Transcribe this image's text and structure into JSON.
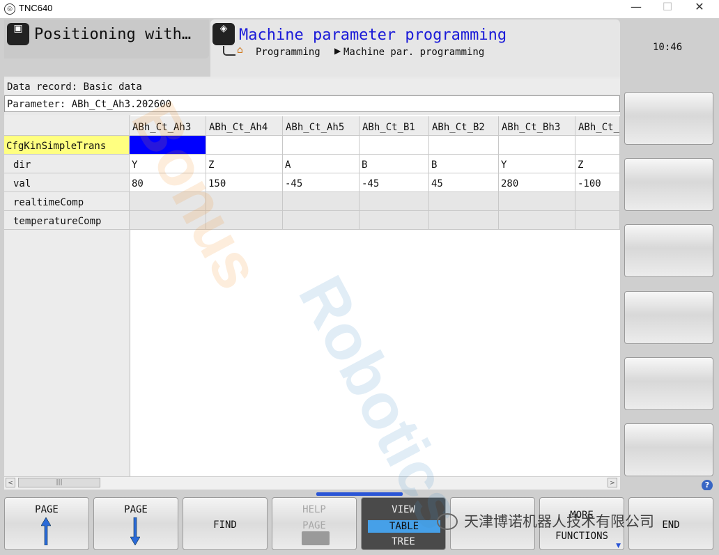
{
  "window": {
    "title": "TNC640",
    "minimize": "—",
    "maximize": "☐",
    "close": "✕"
  },
  "mode_left": {
    "title": "Positioning with…"
  },
  "mode_right": {
    "title": "Machine parameter programming"
  },
  "breadcrumb": {
    "items": [
      "Programming",
      "Machine par. programming"
    ]
  },
  "clock": "10:46",
  "record": "Data record: Basic data",
  "parameter": "Parameter: ABh_Ct_Ah3.202600",
  "table": {
    "columns": [
      "ABh_Ct_Ah3",
      "ABh_Ct_Ah4",
      "ABh_Ct_Ah5",
      "ABh_Ct_B1",
      "ABh_Ct_B2",
      "ABh_Ct_Bh3",
      "ABh_Ct_"
    ],
    "group": "CfgKinSimpleTrans",
    "rows": [
      {
        "label": "dir",
        "values": [
          "Y",
          "Z",
          "A",
          "B",
          "B",
          "Y",
          "Z"
        ]
      },
      {
        "label": "val",
        "values": [
          "80",
          "150",
          "-45",
          "-45",
          "45",
          "280",
          "-100"
        ]
      },
      {
        "label": "realtimeComp",
        "values": [
          "",
          "",
          "",
          "",
          "",
          "",
          ""
        ]
      },
      {
        "label": "temperatureComp",
        "values": [
          "",
          "",
          "",
          "",
          "",
          "",
          ""
        ]
      }
    ]
  },
  "scroll": {
    "left": "<",
    "right": ">",
    "thumb": "|||"
  },
  "help_icon": "?",
  "softkeys": {
    "page_up": "PAGE",
    "page_down": "PAGE",
    "find": "FIND",
    "help_line1": "HELP",
    "help_line2": "PAGE",
    "view": "VIEW",
    "view_table": "TABLE",
    "view_tree": "TREE",
    "more_line1": "MORE",
    "more_line2": "FUNCTIONS",
    "end": "END"
  },
  "watermark": {
    "text1": "Bonus",
    "text2": "Robotics",
    "wechat": "天津博诺机器人技术有限公司"
  },
  "colors": {
    "accent_blue": "#1a1ad8",
    "selected_cell": "#0000ff",
    "group_highlight": "#ffff80",
    "view_active": "#46a0e8"
  }
}
